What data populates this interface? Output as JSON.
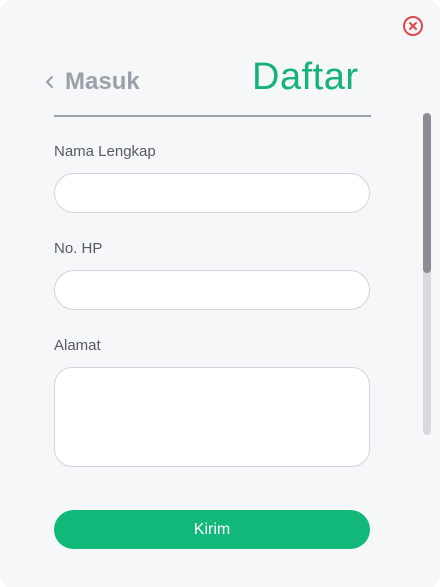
{
  "header": {
    "back_label": "Masuk",
    "title": "Daftar"
  },
  "form": {
    "name_label": "Nama Lengkap",
    "name_value": "",
    "phone_label": "No. HP",
    "phone_value": "",
    "address_label": "Alamat",
    "address_value": ""
  },
  "actions": {
    "submit_label": "Kirim"
  },
  "icons": {
    "close": "close-circle-icon",
    "back": "chevron-left-icon"
  },
  "colors": {
    "accent": "#15b377",
    "close": "#e0474c",
    "muted": "#9aa0a8"
  }
}
